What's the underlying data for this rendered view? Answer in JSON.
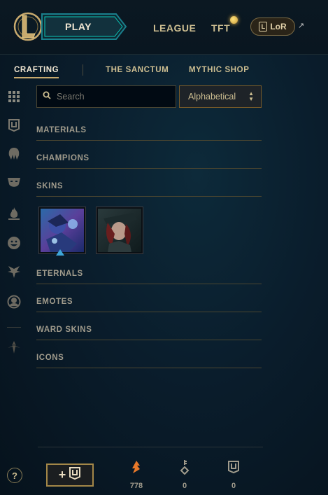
{
  "topbar": {
    "play_label": "PLAY",
    "nav": [
      "LEAGUE",
      "TFT"
    ],
    "lor_label": "LoR",
    "external_glyph": "↗"
  },
  "subnav": {
    "tabs": [
      "CRAFTING",
      "THE SANCTUM",
      "MYTHIC SHOP"
    ],
    "active": "CRAFTING"
  },
  "sidebar": {
    "icons": [
      "grid-icon",
      "chest-icon",
      "champion-helmet-icon",
      "skin-mask-icon",
      "fire-icon",
      "emote-face-icon",
      "ward-icon",
      "profile-icon",
      "arrow-icon"
    ]
  },
  "search": {
    "placeholder": "Search",
    "value": ""
  },
  "sort": {
    "selected": "Alphabetical"
  },
  "sections": [
    "MATERIALS",
    "CHAMPIONS",
    "SKINS",
    "ETERNALS",
    "EMOTES",
    "WARD SKINS",
    "ICONS"
  ],
  "skins": [
    "skin-1",
    "skin-2"
  ],
  "bottom": {
    "help_label": "?",
    "add_plus": "+",
    "currencies": [
      {
        "icon": "orange-essence-icon",
        "value": "778",
        "color": "#e8792a"
      },
      {
        "icon": "key-icon",
        "value": "0",
        "color": "#a09b8c"
      },
      {
        "icon": "chest-icon",
        "value": "0",
        "color": "#a09b8c"
      }
    ]
  },
  "colors": {
    "gold": "#c8aa6e",
    "text": "#a09b8c",
    "accent_blue": "#0ac8b9"
  }
}
